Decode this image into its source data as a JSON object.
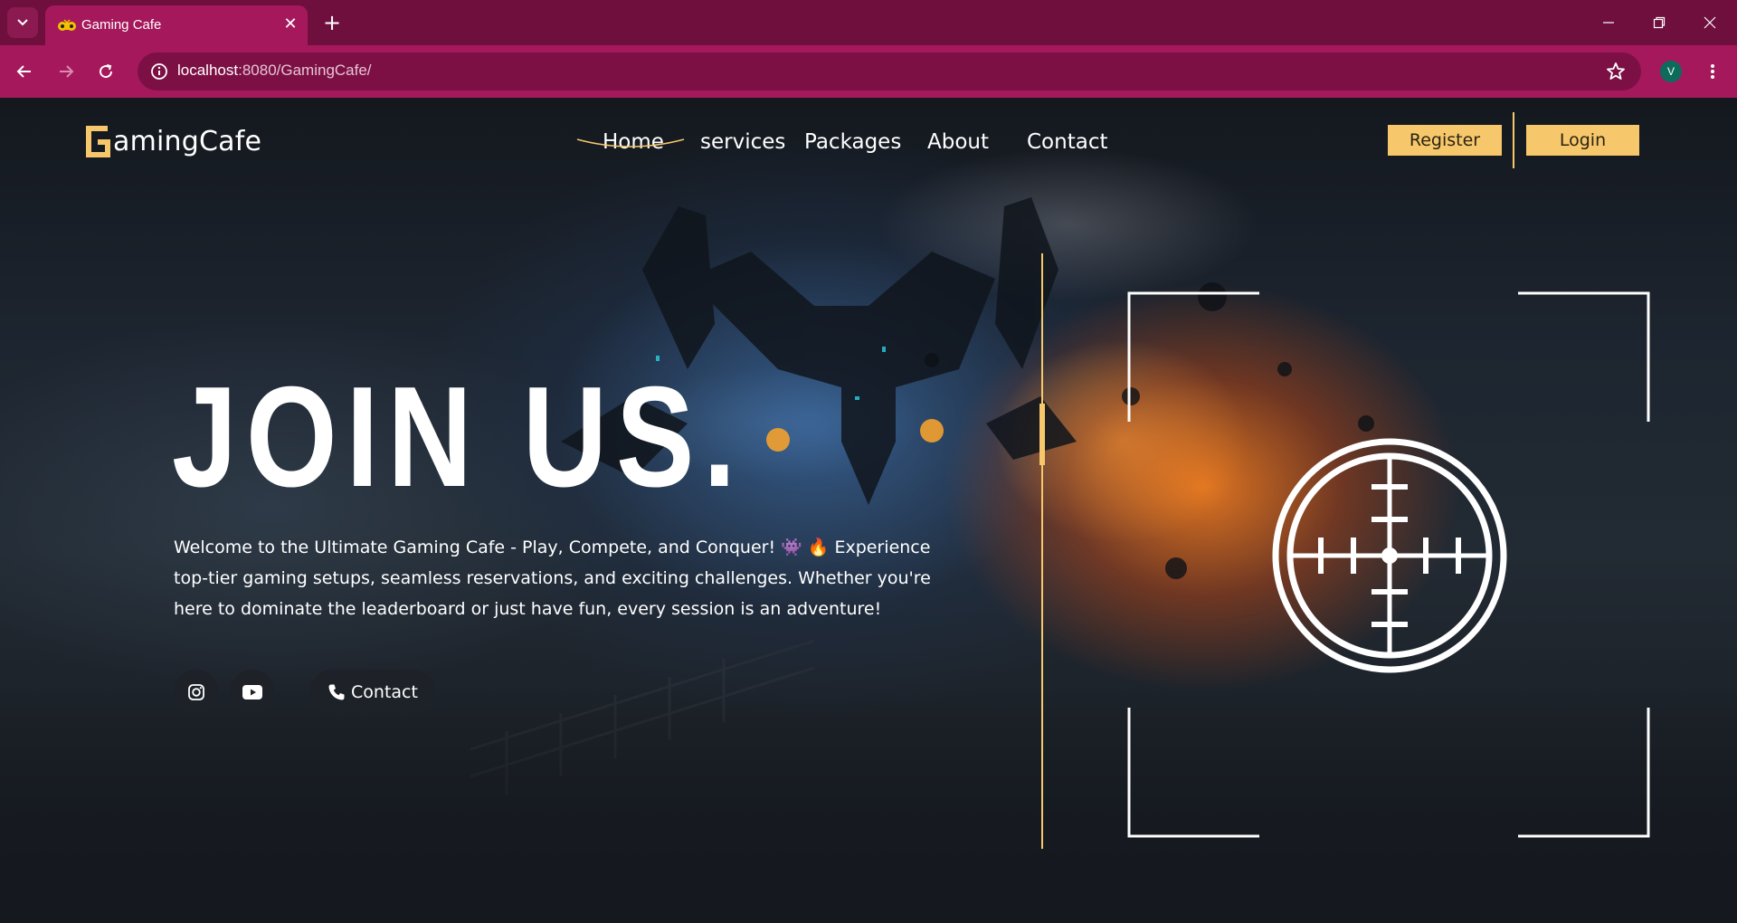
{
  "browser": {
    "tab_title": "Gaming Cafe",
    "url_host": "localhost",
    "url_rest": ":8080/GamingCafe/",
    "profile_initial": "V",
    "accent": "#a5195c",
    "tabbar_color": "#6e0f3e"
  },
  "site": {
    "logo_letter": "G",
    "logo_text": "amingCafe",
    "brand_color": "#f6c86b",
    "nav": [
      {
        "label": "Home",
        "active": true
      },
      {
        "label": "services"
      },
      {
        "label": "Packages"
      },
      {
        "label": "About"
      },
      {
        "label": "Contact"
      }
    ],
    "register_label": "Register",
    "login_label": "Login"
  },
  "hero": {
    "title": "JOIN US.",
    "description": "Welcome to the Ultimate Gaming Cafe - Play, Compete, and Conquer! 👾 🔥 Experience top-tier gaming setups, seamless reservations, and exciting challenges. Whether you're here to dominate the leaderboard or just have fun, every session is an adventure!",
    "social_icons": [
      "instagram-icon",
      "youtube-icon"
    ],
    "contact_label": "Contact",
    "contact_icon": "phone-icon"
  }
}
